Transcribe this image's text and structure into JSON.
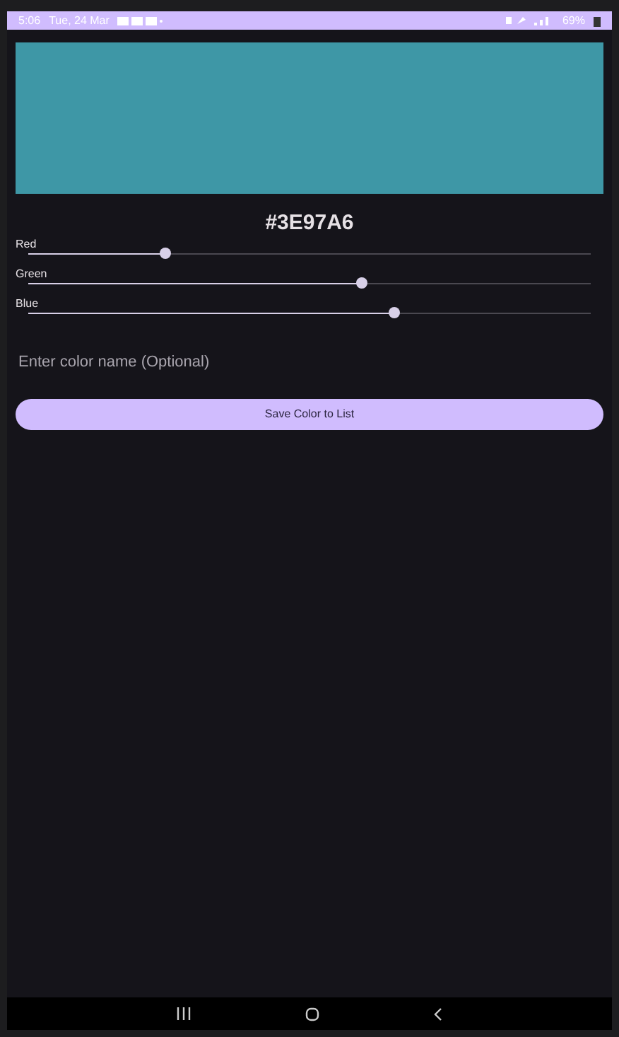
{
  "status_bar": {
    "time": "5:06",
    "date": "Tue, 24 Mar",
    "battery": "69%"
  },
  "hex": "#3E97A6",
  "sliders": [
    {
      "label": "Red",
      "level": 0.243
    },
    {
      "label": "Green",
      "level": 0.592
    },
    {
      "label": "Blue",
      "level": 0.651
    }
  ],
  "name_field": {
    "placeholder": "Enter color name (Optional)"
  },
  "save_button": "Save Color to List"
}
